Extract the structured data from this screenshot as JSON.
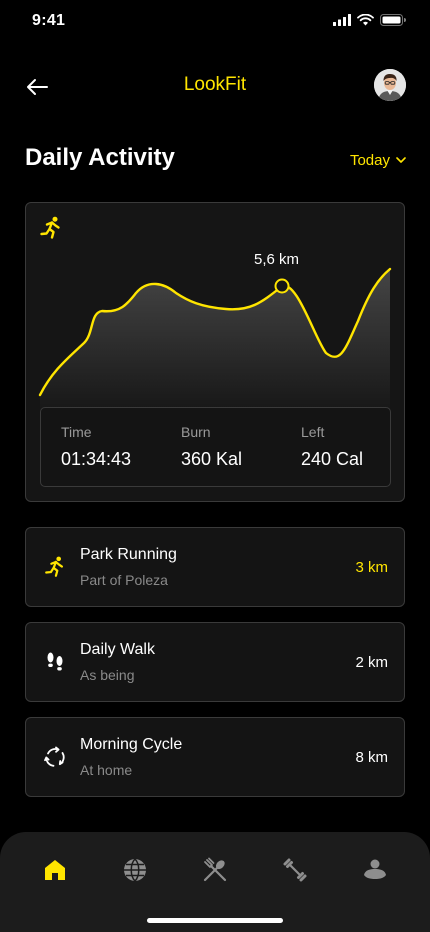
{
  "status_bar": {
    "time": "9:41"
  },
  "header": {
    "title": "LookFit"
  },
  "section": {
    "title": "Daily Activity",
    "period": "Today"
  },
  "activity": {
    "peak_label": "5,6 km",
    "stats": [
      {
        "label": "Time",
        "value": "01:34:43"
      },
      {
        "label": "Burn",
        "value": "360 Kal"
      },
      {
        "label": "Left",
        "value": "240 Cal"
      }
    ]
  },
  "activities": [
    {
      "name": "Park Running",
      "subtitle": "Part of Poleza",
      "distance": "3 km",
      "icon": "running-icon",
      "highlight": true
    },
    {
      "name": "Daily Walk",
      "subtitle": "As being",
      "distance": "2 km",
      "icon": "footprints-icon",
      "highlight": false
    },
    {
      "name": "Morning Cycle",
      "subtitle": "At home",
      "distance": "8 km",
      "icon": "cycle-icon",
      "highlight": false
    }
  ],
  "tabs": [
    {
      "icon": "home-icon",
      "active": true
    },
    {
      "icon": "globe-icon",
      "active": false
    },
    {
      "icon": "fork-spoon-icon",
      "active": false
    },
    {
      "icon": "dumbbell-icon",
      "active": false
    },
    {
      "icon": "profile-icon",
      "active": false
    }
  ],
  "colors": {
    "accent": "#FFE500",
    "background": "#000000",
    "card": "#151515",
    "border": "#3a3a3a"
  }
}
